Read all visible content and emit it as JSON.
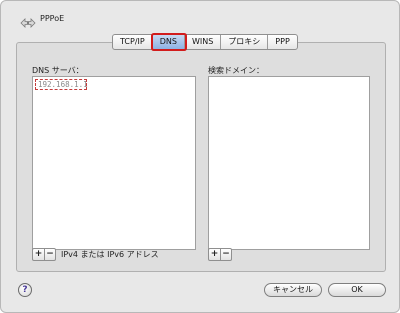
{
  "window": {
    "title": "PPPoE"
  },
  "tabs": [
    {
      "label": "TCP/IP"
    },
    {
      "label": "DNS",
      "selected": true
    },
    {
      "label": "WINS"
    },
    {
      "label": "プロキシ"
    },
    {
      "label": "PPP"
    }
  ],
  "dns_servers": {
    "label": "DNS サーバ：",
    "entries": [
      "192.168.1.1"
    ],
    "add_label": "+",
    "remove_label": "−",
    "hint": "IPv4 または IPv6 アドレス"
  },
  "search_domains": {
    "label": "検索ドメイン：",
    "add_label": "+",
    "remove_label": "−"
  },
  "footer": {
    "help_label": "?",
    "cancel_label": "キャンセル",
    "ok_label": "OK"
  },
  "colors": {
    "selected_tab": "#8eb2e3",
    "highlight_border": "#d21c1c",
    "window_bg": "#e8e8e8"
  }
}
